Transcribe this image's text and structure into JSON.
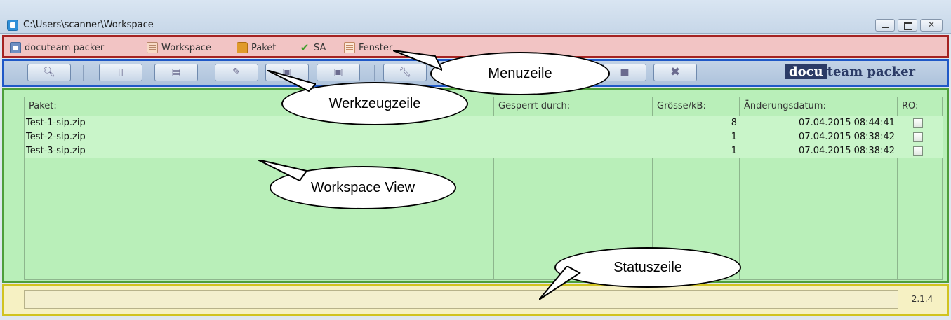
{
  "window": {
    "title": "C:\\Users\\scanner\\Workspace",
    "controls": [
      "minimize",
      "maximize",
      "close"
    ]
  },
  "menubar": {
    "items": [
      {
        "label": "docuteam packer",
        "icon": "packer-icon"
      },
      {
        "label": "Workspace",
        "icon": "workspace-icon"
      },
      {
        "label": "Paket",
        "icon": "package-icon"
      },
      {
        "label": "SA",
        "icon": "checkmark-icon"
      },
      {
        "label": "Fenster",
        "icon": "window-list-icon"
      }
    ]
  },
  "toolbar": {
    "buttons": [
      "search-icon",
      "new-document-icon",
      "open-document-icon",
      "edit-icon",
      "open-package-icon",
      "package-icon",
      "settings-wrench-icon",
      "copy-icon",
      "delete-icon"
    ],
    "brand_docu": "docu",
    "brand_rest": "team packer"
  },
  "table": {
    "headers": {
      "paket": "Paket:",
      "locked_by": "Gesperrt durch:",
      "size": "Grösse/kB:",
      "modified": "Änderungsdatum:",
      "ro": "RO:"
    },
    "rows": [
      {
        "paket": "Test-1-sip.zip",
        "locked_by": "",
        "size": "8",
        "modified": "07.04.2015 08:44:41",
        "ro": false
      },
      {
        "paket": "Test-2-sip.zip",
        "locked_by": "",
        "size": "1",
        "modified": "07.04.2015 08:38:42",
        "ro": false
      },
      {
        "paket": "Test-3-sip.zip",
        "locked_by": "",
        "size": "1",
        "modified": "07.04.2015 08:38:42",
        "ro": false
      }
    ]
  },
  "statusbar": {
    "text": "",
    "version": "2.1.4"
  },
  "callouts": {
    "menuzeile": "Menuzeile",
    "werkzeugzeile": "Werkzeugzeile",
    "workspace_view": "Workspace View",
    "statuszeile": "Statuszeile"
  },
  "colors": {
    "menubar_border": "#a52222",
    "toolbar_border": "#1f58c7",
    "workspace_border": "#4d9e3b",
    "statusbar_border": "#d1c31f"
  }
}
